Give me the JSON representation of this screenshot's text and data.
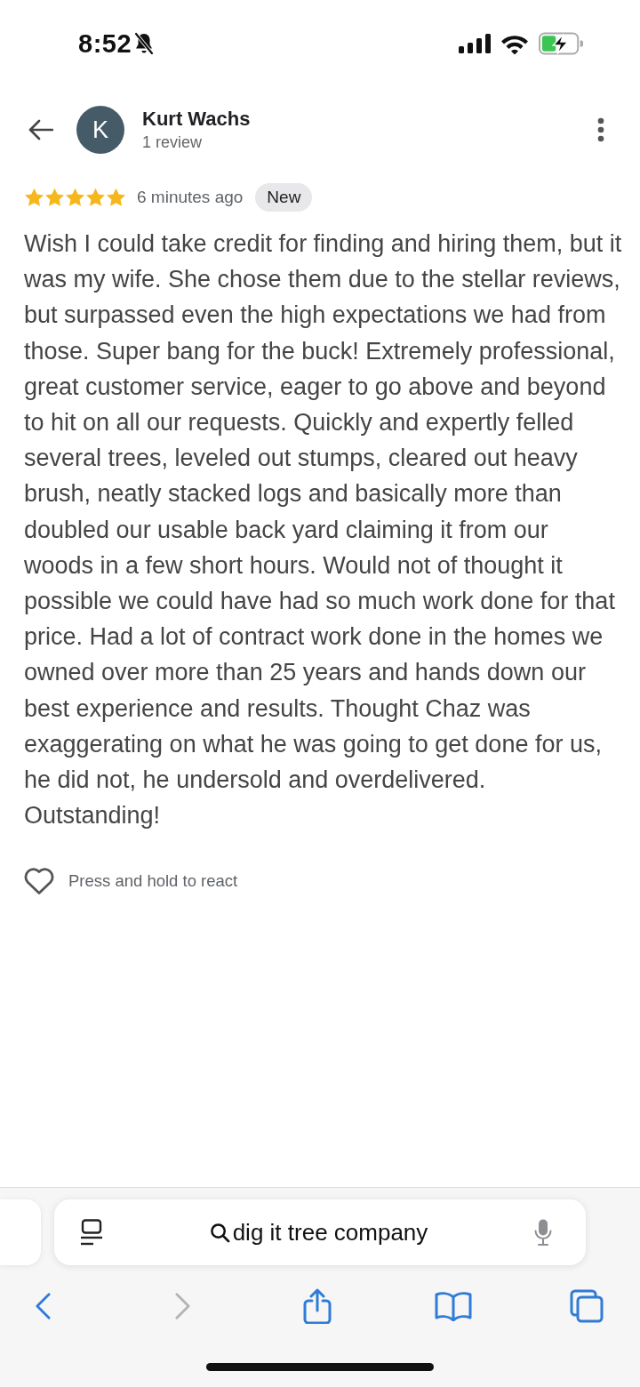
{
  "status_bar": {
    "time": "8:52",
    "silent": true
  },
  "reviewer": {
    "initial": "K",
    "name": "Kurt Wachs",
    "review_count": "1 review"
  },
  "review": {
    "stars": 5,
    "time": "6 minutes ago",
    "badge": "New",
    "text": "Wish I could take credit for finding and hiring them, but it was my wife. She chose them due to the stellar reviews, but surpassed even the high expectations we had from those. Super bang for the buck! Extremely professional, great customer service, eager to go above and beyond to hit on all our requests. Quickly and expertly felled several trees, leveled out stumps, cleared out heavy brush, neatly stacked logs and basically more than doubled our usable back yard claiming it from our woods in a few short hours. Would not of thought it possible we could have had so much work done for that price. Had a lot of contract work done in the homes we owned over more than 25 years and hands down our best experience and results. Thought Chaz was exaggerating on what he was going to get done for us, he did not, he undersold and overdelivered. Outstanding!"
  },
  "reaction": {
    "label": "Press and hold to react"
  },
  "browser": {
    "search_query": "dig it tree company",
    "forward_disabled": true
  }
}
